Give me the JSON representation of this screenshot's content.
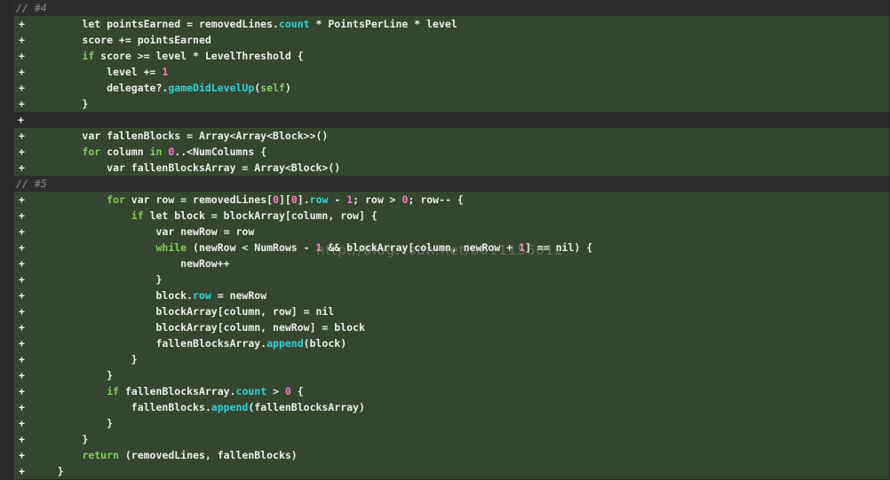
{
  "watermark": "http://blog.csdn.net/u011156012",
  "colors": {
    "added_bg": "#34462f",
    "comment_fg": "#8f8f8f",
    "keyword": "#7fd15a",
    "number": "#ff7acb",
    "member": "#2fd3d6"
  },
  "lines": [
    {
      "kind": "comment",
      "marker": "",
      "indent": "",
      "tokens": [
        {
          "t": "// #4",
          "c": ""
        }
      ]
    },
    {
      "kind": "added",
      "marker": "+",
      "indent": "        ",
      "tokens": [
        {
          "t": "let pointsEarned = removedLines.",
          "c": ""
        },
        {
          "t": "count",
          "c": "mem"
        },
        {
          "t": " * PointsPerLine * level",
          "c": ""
        }
      ]
    },
    {
      "kind": "added",
      "marker": "+",
      "indent": "        ",
      "tokens": [
        {
          "t": "score += pointsEarned",
          "c": ""
        }
      ]
    },
    {
      "kind": "added",
      "marker": "+",
      "indent": "        ",
      "tokens": [
        {
          "t": "if",
          "c": "kw"
        },
        {
          "t": " score >= level * LevelThreshold {",
          "c": ""
        }
      ]
    },
    {
      "kind": "added",
      "marker": "+",
      "indent": "            ",
      "tokens": [
        {
          "t": "level += ",
          "c": ""
        },
        {
          "t": "1",
          "c": "num"
        }
      ]
    },
    {
      "kind": "added",
      "marker": "+",
      "indent": "            ",
      "tokens": [
        {
          "t": "delegate?.",
          "c": ""
        },
        {
          "t": "gameDidLevelUp",
          "c": "mem"
        },
        {
          "t": "(",
          "c": ""
        },
        {
          "t": "self",
          "c": "kw"
        },
        {
          "t": ")",
          "c": ""
        }
      ]
    },
    {
      "kind": "added",
      "marker": "+",
      "indent": "        ",
      "tokens": [
        {
          "t": "}",
          "c": ""
        }
      ]
    },
    {
      "kind": "added",
      "marker": "+",
      "indent": "",
      "tokens": [
        {
          "t": "",
          "c": ""
        }
      ]
    },
    {
      "kind": "added",
      "marker": "+",
      "indent": "        ",
      "tokens": [
        {
          "t": "var fallenBlocks = Array<Array<Block>>()",
          "c": ""
        }
      ]
    },
    {
      "kind": "added",
      "marker": "+",
      "indent": "        ",
      "tokens": [
        {
          "t": "for",
          "c": "kw"
        },
        {
          "t": " column ",
          "c": ""
        },
        {
          "t": "in",
          "c": "kw"
        },
        {
          "t": " ",
          "c": ""
        },
        {
          "t": "0",
          "c": "num"
        },
        {
          "t": "..<NumColumns {",
          "c": ""
        }
      ]
    },
    {
      "kind": "added",
      "marker": "+",
      "indent": "            ",
      "tokens": [
        {
          "t": "var fallenBlocksArray = Array<Block>()",
          "c": ""
        }
      ]
    },
    {
      "kind": "comment",
      "marker": "",
      "indent": "",
      "tokens": [
        {
          "t": "// #5",
          "c": ""
        }
      ]
    },
    {
      "kind": "added",
      "marker": "+",
      "indent": "            ",
      "tokens": [
        {
          "t": "for",
          "c": "kw"
        },
        {
          "t": " var row = removedLines[",
          "c": ""
        },
        {
          "t": "0",
          "c": "num"
        },
        {
          "t": "][",
          "c": ""
        },
        {
          "t": "0",
          "c": "num"
        },
        {
          "t": "].",
          "c": ""
        },
        {
          "t": "row",
          "c": "mem"
        },
        {
          "t": " - ",
          "c": ""
        },
        {
          "t": "1",
          "c": "num"
        },
        {
          "t": "; row > ",
          "c": ""
        },
        {
          "t": "0",
          "c": "num"
        },
        {
          "t": "; row-- {",
          "c": ""
        }
      ]
    },
    {
      "kind": "added",
      "marker": "+",
      "indent": "                ",
      "tokens": [
        {
          "t": "if",
          "c": "kw"
        },
        {
          "t": " let block = blockArray[column, row] {",
          "c": ""
        }
      ]
    },
    {
      "kind": "added",
      "marker": "+",
      "indent": "                    ",
      "tokens": [
        {
          "t": "var newRow = row",
          "c": ""
        }
      ]
    },
    {
      "kind": "added",
      "marker": "+",
      "indent": "                    ",
      "tokens": [
        {
          "t": "while",
          "c": "kw"
        },
        {
          "t": " (newRow < NumRows - ",
          "c": ""
        },
        {
          "t": "1",
          "c": "num"
        },
        {
          "t": " && blockArray[column, newRow + ",
          "c": ""
        },
        {
          "t": "1",
          "c": "num"
        },
        {
          "t": "] == nil) {",
          "c": ""
        }
      ]
    },
    {
      "kind": "added",
      "marker": "+",
      "indent": "                        ",
      "tokens": [
        {
          "t": "newRow++",
          "c": ""
        }
      ]
    },
    {
      "kind": "added",
      "marker": "+",
      "indent": "                    ",
      "tokens": [
        {
          "t": "}",
          "c": ""
        }
      ]
    },
    {
      "kind": "added",
      "marker": "+",
      "indent": "                    ",
      "tokens": [
        {
          "t": "block.",
          "c": ""
        },
        {
          "t": "row",
          "c": "mem"
        },
        {
          "t": " = newRow",
          "c": ""
        }
      ]
    },
    {
      "kind": "added",
      "marker": "+",
      "indent": "                    ",
      "tokens": [
        {
          "t": "blockArray[column, row] = nil",
          "c": ""
        }
      ]
    },
    {
      "kind": "added",
      "marker": "+",
      "indent": "                    ",
      "tokens": [
        {
          "t": "blockArray[column, newRow] = block",
          "c": ""
        }
      ]
    },
    {
      "kind": "added",
      "marker": "+",
      "indent": "                    ",
      "tokens": [
        {
          "t": "fallenBlocksArray.",
          "c": ""
        },
        {
          "t": "append",
          "c": "mem"
        },
        {
          "t": "(block)",
          "c": ""
        }
      ]
    },
    {
      "kind": "added",
      "marker": "+",
      "indent": "                ",
      "tokens": [
        {
          "t": "}",
          "c": ""
        }
      ]
    },
    {
      "kind": "added",
      "marker": "+",
      "indent": "            ",
      "tokens": [
        {
          "t": "}",
          "c": ""
        }
      ]
    },
    {
      "kind": "added",
      "marker": "+",
      "indent": "            ",
      "tokens": [
        {
          "t": "if",
          "c": "kw"
        },
        {
          "t": " fallenBlocksArray.",
          "c": ""
        },
        {
          "t": "count",
          "c": "mem"
        },
        {
          "t": " > ",
          "c": ""
        },
        {
          "t": "0",
          "c": "num"
        },
        {
          "t": " {",
          "c": ""
        }
      ]
    },
    {
      "kind": "added",
      "marker": "+",
      "indent": "                ",
      "tokens": [
        {
          "t": "fallenBlocks.",
          "c": ""
        },
        {
          "t": "append",
          "c": "mem"
        },
        {
          "t": "(fallenBlocksArray)",
          "c": ""
        }
      ]
    },
    {
      "kind": "added",
      "marker": "+",
      "indent": "            ",
      "tokens": [
        {
          "t": "}",
          "c": ""
        }
      ]
    },
    {
      "kind": "added",
      "marker": "+",
      "indent": "        ",
      "tokens": [
        {
          "t": "}",
          "c": ""
        }
      ]
    },
    {
      "kind": "added",
      "marker": "+",
      "indent": "        ",
      "tokens": [
        {
          "t": "return",
          "c": "kw"
        },
        {
          "t": " (removedLines, fallenBlocks)",
          "c": ""
        }
      ]
    },
    {
      "kind": "added",
      "marker": "+",
      "indent": "    ",
      "tokens": [
        {
          "t": "}",
          "c": ""
        }
      ]
    }
  ]
}
